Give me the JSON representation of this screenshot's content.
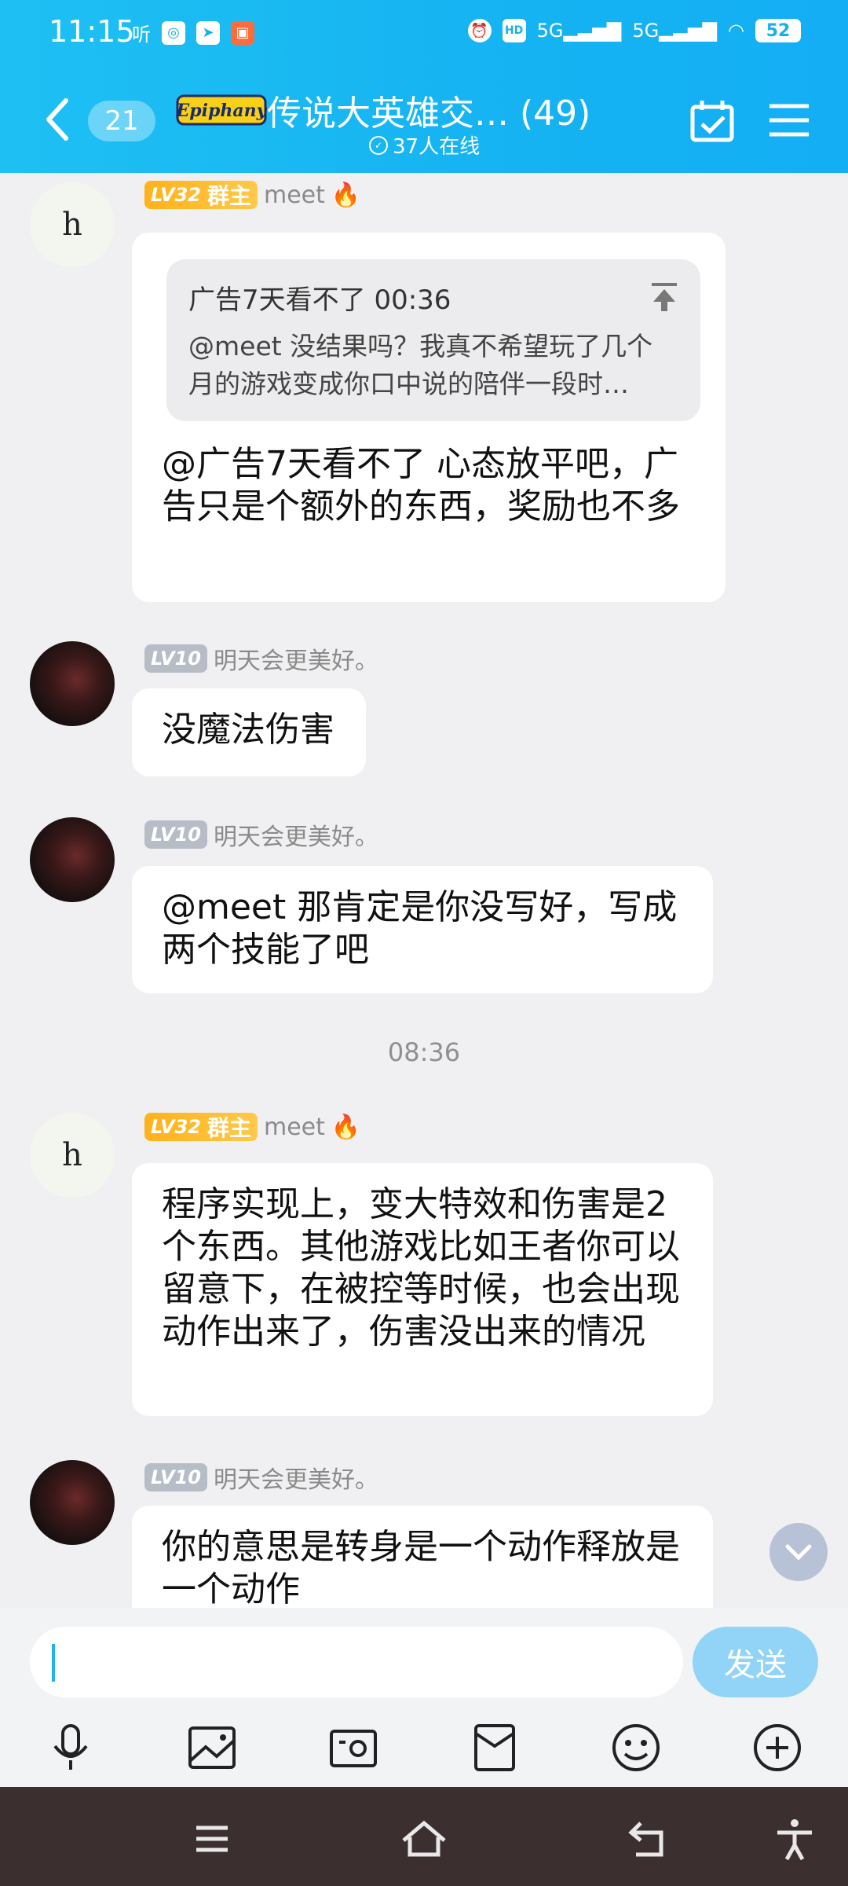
{
  "status": {
    "time": "11:15",
    "left_tag": "听",
    "battery": "52",
    "hd": "HD",
    "sig1": "5G",
    "sig2": "5G"
  },
  "header": {
    "unread": "21",
    "logo_text": "Epiphany",
    "title": "传说大英雄交…  (49)",
    "online": "37人在线"
  },
  "messages": [
    {
      "level": "LV32",
      "role": "群主",
      "name": "meet",
      "avatar_text": "h",
      "quote": {
        "head": "广告7天看不了  00:36",
        "text": "@meet  没结果吗？我真不希望玩了几个月的游戏变成你口中说的陪伴一段时…"
      },
      "text": "@广告7天看不了  心态放平吧，广告只是个额外的东西，奖励也不多"
    },
    {
      "level": "LV10",
      "name": "明天会更美好。",
      "text": "没魔法伤害"
    },
    {
      "level": "LV10",
      "name": "明天会更美好。",
      "text": "@meet  那肯定是你没写好，写成两个技能了吧"
    },
    {
      "timestamp": "08:36"
    },
    {
      "level": "LV32",
      "role": "群主",
      "name": "meet",
      "avatar_text": "h",
      "text": "程序实现上，变大特效和伤害是2个东西。其他游戏比如王者你可以留意下，在被控等时候，也会出现动作出来了，伤害没出来的情况"
    },
    {
      "level": "LV10",
      "name": "明天会更美好。",
      "text": "你的意思是转身是一个动作释放是一个动作"
    }
  ],
  "input": {
    "placeholder": "",
    "send_label": "发送"
  },
  "toolbar_icons": [
    "microphone-icon",
    "image-icon",
    "camera-icon",
    "red-packet-icon",
    "emoji-icon",
    "plus-icon"
  ],
  "colors": {
    "header": "#16b4f2",
    "owner_badge": "#ffb21a",
    "level_badge": "#b7bdc7",
    "send": "#92d4f7"
  }
}
